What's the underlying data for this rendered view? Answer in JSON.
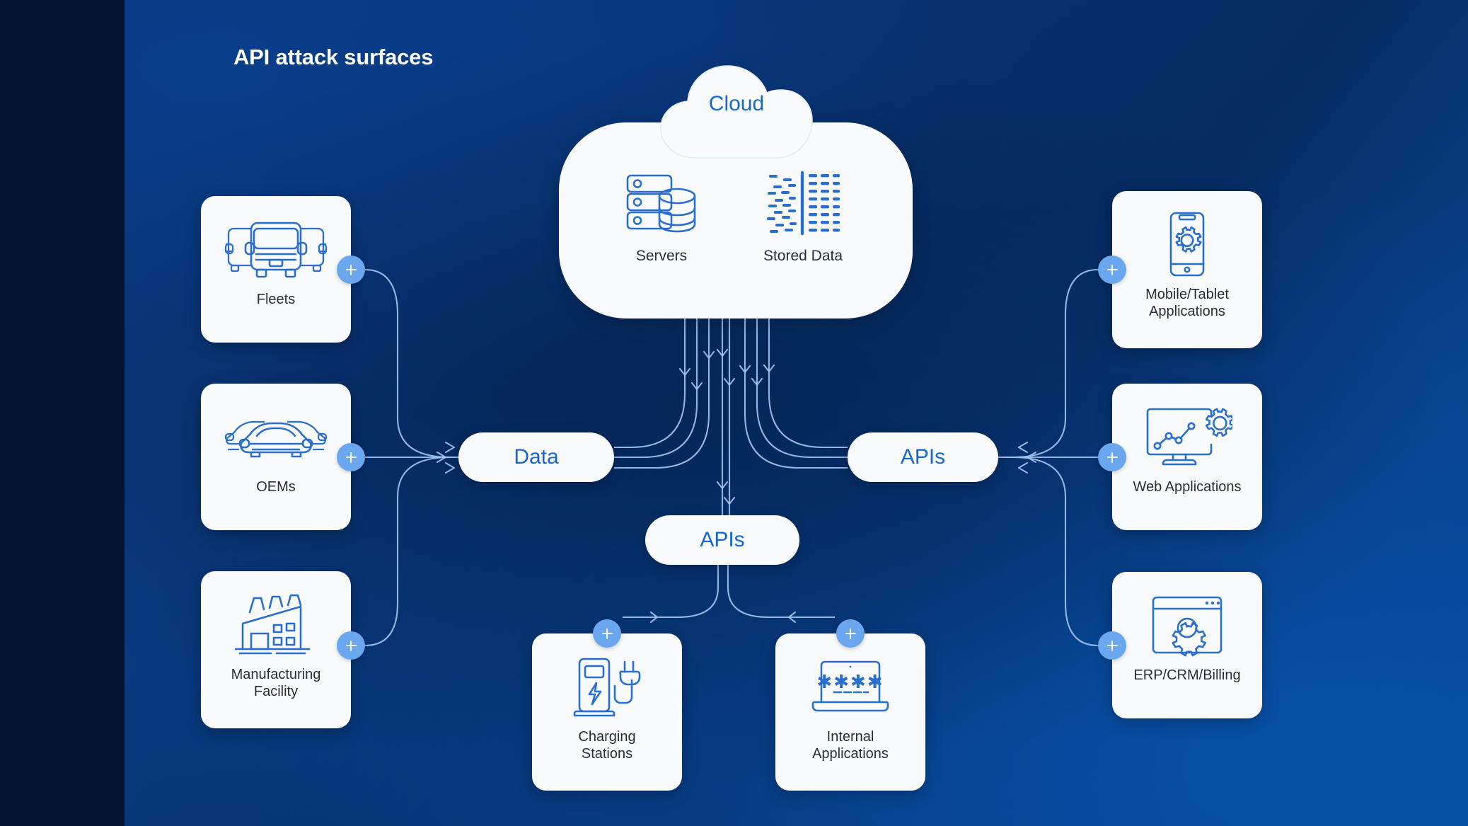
{
  "title": "API attack surfaces",
  "colors": {
    "accent_blue": "#1668cf",
    "icon_blue": "#2a6fd0",
    "plus_badge": "#6aa7ef",
    "card_bg": "#f9fafb",
    "bg_dark": "#03152f",
    "bg_gradient_from": "#0b3d84",
    "bg_gradient_to": "#0a4c9d",
    "line": "#9cc2ee",
    "caption_text": "#262f3a"
  },
  "cloud": {
    "label": "Cloud",
    "badge_icon": "cloud-icon",
    "items": [
      {
        "label": "Servers",
        "icon": "servers-icon"
      },
      {
        "label": "Stored Data",
        "icon": "stored-data-icon"
      }
    ]
  },
  "hubs": [
    {
      "id": "data",
      "label": "Data"
    },
    {
      "id": "apis-right",
      "label": "APIs"
    },
    {
      "id": "apis-bottom",
      "label": "APIs"
    }
  ],
  "left_cards": [
    {
      "label": "Fleets",
      "icon": "trucks-icon",
      "badge": "plus-icon"
    },
    {
      "label": "OEMs",
      "icon": "cars-icon",
      "badge": "plus-icon"
    },
    {
      "label": "Manufacturing\nFacility",
      "line1": "Manufacturing",
      "line2": "Facility",
      "icon": "factory-icon",
      "badge": "plus-icon"
    }
  ],
  "right_cards": [
    {
      "line1": "Mobile/Tablet",
      "line2": "Applications",
      "icon": "mobile-gear-icon",
      "badge": "plus-icon"
    },
    {
      "line1": "Web Applications",
      "line2": "",
      "icon": "monitor-gear-icon",
      "badge": "plus-icon"
    },
    {
      "line1": "ERP/CRM/Billing",
      "line2": "",
      "icon": "browser-gear-icon",
      "badge": "plus-icon"
    }
  ],
  "bottom_cards": [
    {
      "line1": "Charging",
      "line2": "Stations",
      "icon": "charging-station-icon",
      "badge": "plus-icon"
    },
    {
      "line1": "Internal",
      "line2": "Applications",
      "icon": "laptop-password-icon",
      "badge": "plus-icon"
    }
  ]
}
